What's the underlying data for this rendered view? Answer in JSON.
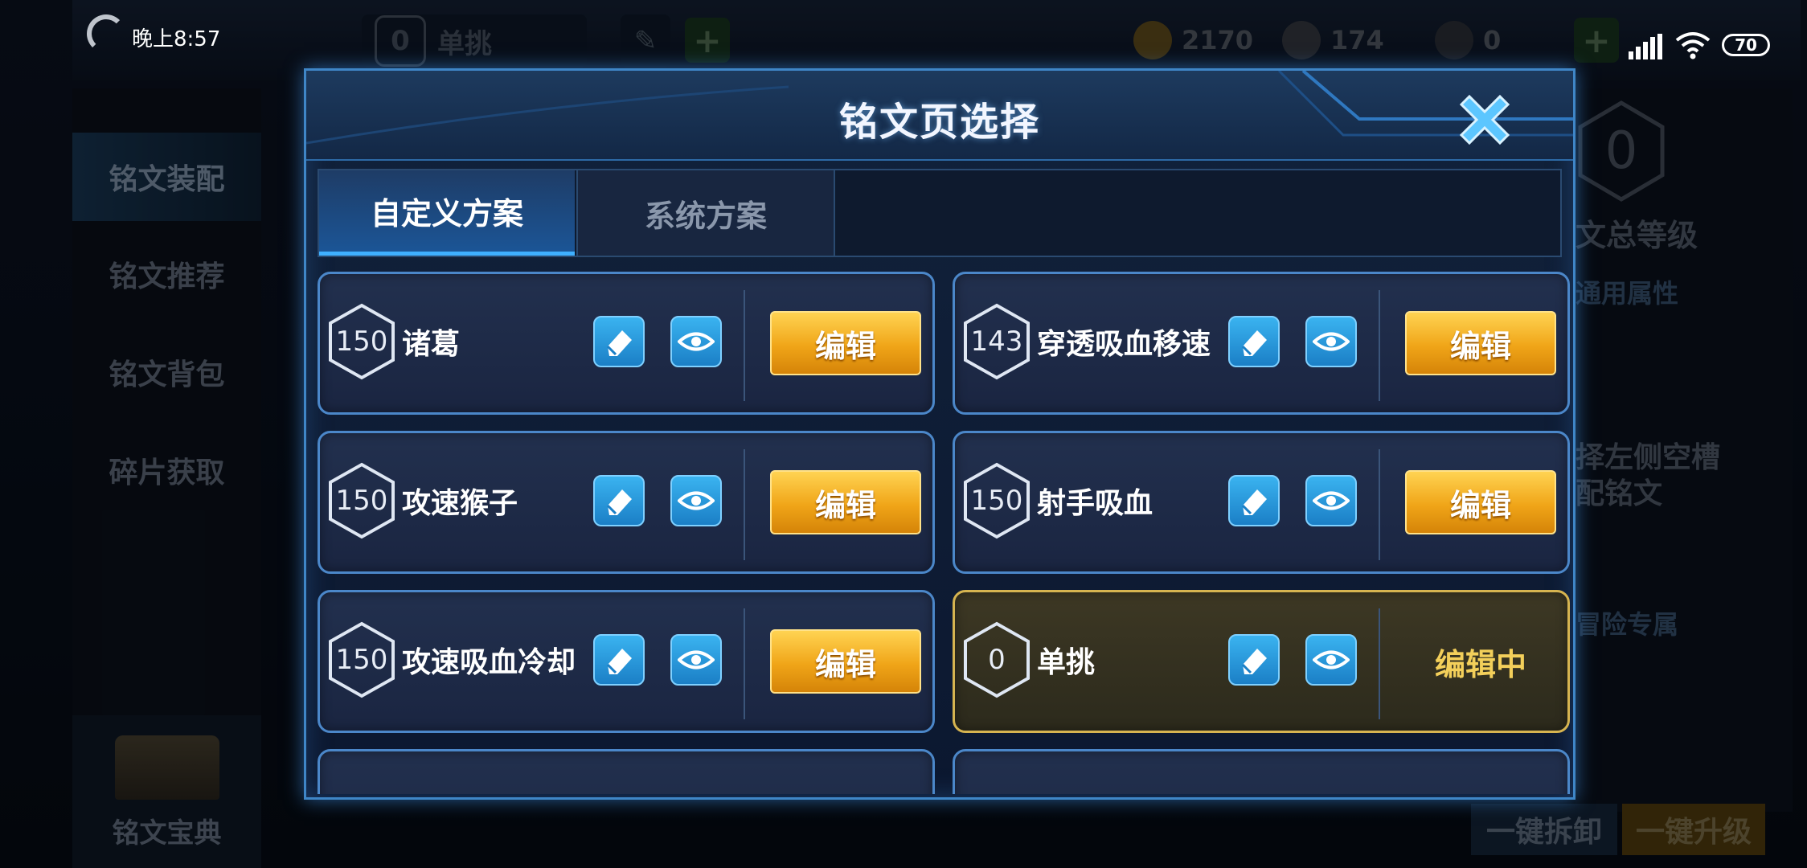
{
  "status_bar": {
    "time": "晚上8:57",
    "battery": "70"
  },
  "background": {
    "top_scheme_number": "0",
    "top_scheme_name": "单挑",
    "gold": "2170",
    "diamonds": "174",
    "vouchers": "0",
    "sidebar": [
      {
        "label": "铭文装配",
        "active": true
      },
      {
        "label": "铭文推荐",
        "active": false
      },
      {
        "label": "铭文背包",
        "active": false
      },
      {
        "label": "碎片获取",
        "active": false
      }
    ],
    "codex_label": "铭文宝典",
    "total_level_value": "0",
    "total_level_label": "文总等级",
    "general_attr_label": "通用属性",
    "empty_hint_line1": "择左侧空槽",
    "empty_hint_line2": "配铭文",
    "adventure_label": "冒险专属",
    "btn_unequip_all": "一键拆卸",
    "btn_upgrade_all": "一键升级",
    "colors": {
      "upgrade_bg": "#6b4b10",
      "unequip_bg": "#1a2c44"
    }
  },
  "modal": {
    "title": "铭文页选择",
    "tabs": [
      {
        "label": "自定义方案",
        "active": true
      },
      {
        "label": "系统方案",
        "active": false
      }
    ],
    "edit_label": "编辑",
    "editing_label": "编辑中",
    "pages": [
      {
        "level": "150",
        "name": "诸葛",
        "state": "normal"
      },
      {
        "level": "143",
        "name": "穿透吸血移速",
        "state": "normal"
      },
      {
        "level": "150",
        "name": "攻速猴子",
        "state": "normal"
      },
      {
        "level": "150",
        "name": "射手吸血",
        "state": "normal"
      },
      {
        "level": "150",
        "name": "攻速吸血冷却",
        "state": "normal"
      },
      {
        "level": "0",
        "name": "单挑",
        "state": "editing"
      }
    ],
    "colors": {
      "edit_button": "#f0a518",
      "active_card_border": "#d6b450",
      "card_border": "#4b87c9"
    }
  }
}
